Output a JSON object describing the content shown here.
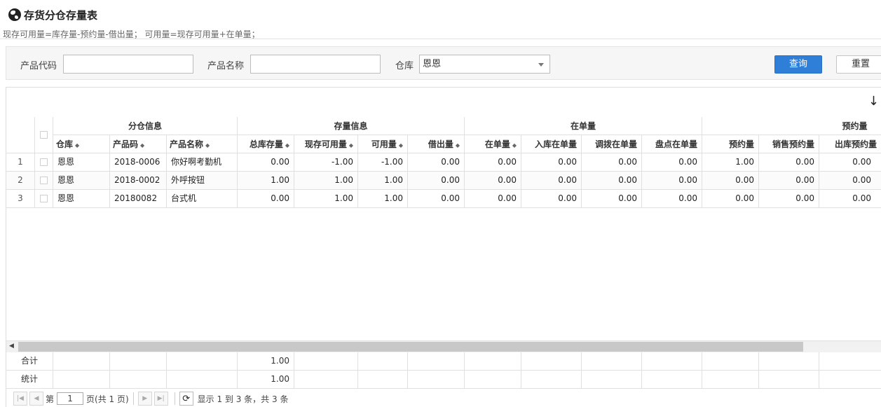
{
  "page": {
    "title": "存货分仓存量表",
    "formula": "现存可用量=库存量-预约量-借出量； 可用量=现存可用量+在单量；"
  },
  "filters": {
    "product_code_label": "产品代码",
    "product_code_value": "",
    "product_name_label": "产品名称",
    "product_name_value": "",
    "warehouse_label": "仓库",
    "warehouse_value": "恩恩",
    "query_label": "查询",
    "reset_label": "重置"
  },
  "toolbar": {
    "export_icon": "↓"
  },
  "table": {
    "groups": {
      "warehouse_info": "分仓信息",
      "stock_info": "存量信息",
      "in_order": "在单量",
      "reserved": "预约量"
    },
    "columns": {
      "warehouse": "仓库",
      "product_code": "产品码",
      "product_name": "产品名称",
      "total_stock": "总库存量",
      "current_available": "现存可用量",
      "available": "可用量",
      "lent": "借出量",
      "in_order_qty": "在单量",
      "inbound_in_order": "入库在单量",
      "transfer_in_order": "调拨在单量",
      "stocktake_in_order": "盘点在单量",
      "reserved_qty": "预约量",
      "sales_reserved": "销售预约量",
      "outbound_reserved": "出库预约量"
    },
    "rows": [
      [
        "1",
        "恩恩",
        "2018-0006",
        "你好啊考勤机",
        "0.00",
        "-1.00",
        "-1.00",
        "0.00",
        "0.00",
        "0.00",
        "0.00",
        "0.00",
        "1.00",
        "0.00",
        "0.00"
      ],
      [
        "2",
        "恩恩",
        "2018-0002",
        "外呼按钮",
        "1.00",
        "1.00",
        "1.00",
        "0.00",
        "0.00",
        "0.00",
        "0.00",
        "0.00",
        "0.00",
        "0.00",
        "0.00"
      ],
      [
        "3",
        "恩恩",
        "20180082",
        "台式机",
        "0.00",
        "1.00",
        "1.00",
        "0.00",
        "0.00",
        "0.00",
        "0.00",
        "0.00",
        "0.00",
        "0.00",
        "0.00"
      ]
    ],
    "footer": {
      "total_label": "合计",
      "total_stock_sum": "1.00",
      "stat_label": "统计",
      "stat_stock": "1.00"
    }
  },
  "pager": {
    "page_prefix": "第",
    "page_value": "1",
    "page_suffix": "页(共 1 页)",
    "summary": "显示 1 到 3 条，共 3 条"
  }
}
